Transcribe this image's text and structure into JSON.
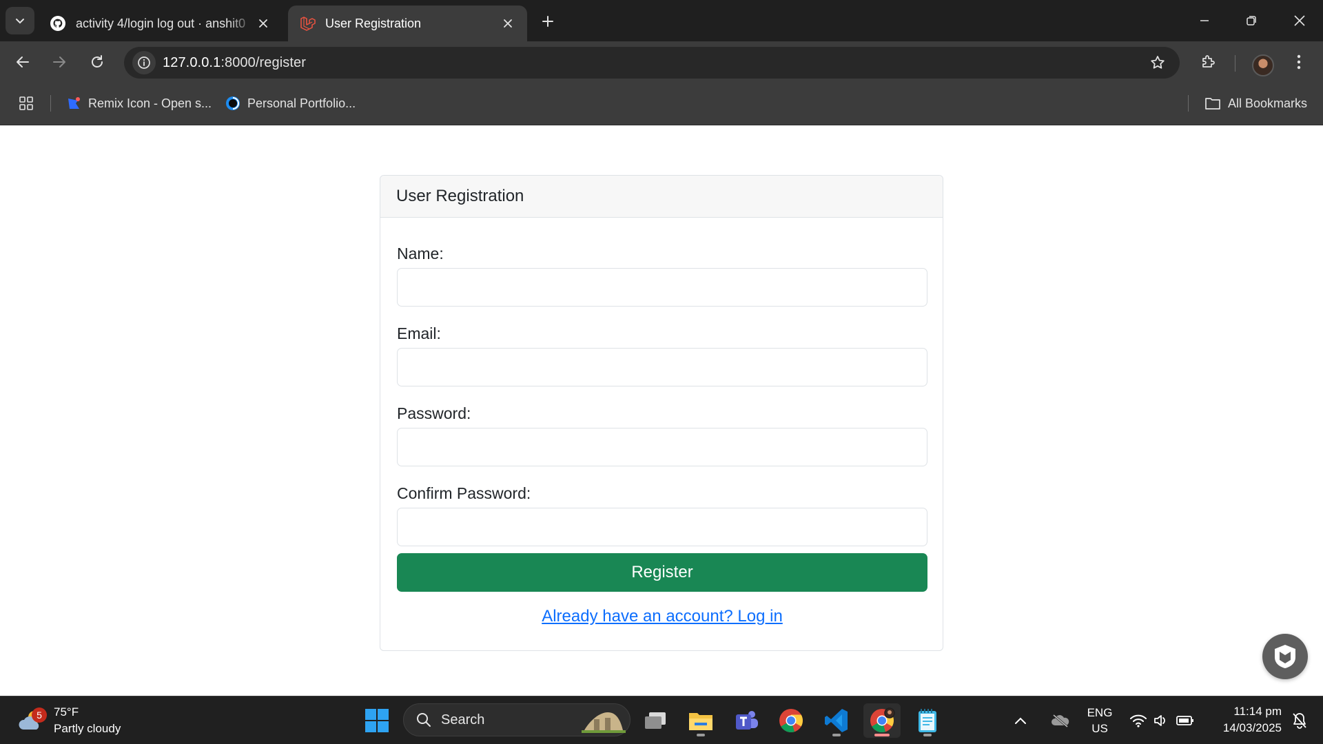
{
  "browser": {
    "tabs": [
      {
        "title": "activity 4/login log out · anshit0",
        "icon": "github-icon",
        "active": false
      },
      {
        "title": "User Registration",
        "icon": "laravel-icon",
        "active": true
      }
    ],
    "url": {
      "host": "127.0.0.1",
      "path": ":8000/register"
    },
    "bookmarks": [
      {
        "label": "Remix Icon - Open s...",
        "icon": "remix-icon"
      },
      {
        "label": "Personal Portfolio...",
        "icon": "portfolio-icon"
      }
    ],
    "all_bookmarks_label": "All Bookmarks"
  },
  "form": {
    "title": "User Registration",
    "fields": [
      {
        "label": "Name:",
        "value": ""
      },
      {
        "label": "Email:",
        "value": ""
      },
      {
        "label": "Password:",
        "value": ""
      },
      {
        "label": "Confirm Password:",
        "value": ""
      }
    ],
    "submit_label": "Register",
    "login_link": "Already have an account? Log in"
  },
  "colors": {
    "primary_button": "#198754",
    "link": "#0d6efd"
  },
  "taskbar": {
    "weather": {
      "temp": "75°F",
      "condition": "Partly cloudy",
      "badge": "5"
    },
    "search_label": "Search",
    "language": {
      "line1": "ENG",
      "line2": "US"
    },
    "time": "11:14 pm",
    "date": "14/03/2025",
    "apps": [
      "windows-start-icon",
      "task-view-icon",
      "file-explorer-icon",
      "teams-icon",
      "chrome-icon",
      "vscode-icon",
      "chrome-profile-icon",
      "notepad-icon"
    ]
  }
}
